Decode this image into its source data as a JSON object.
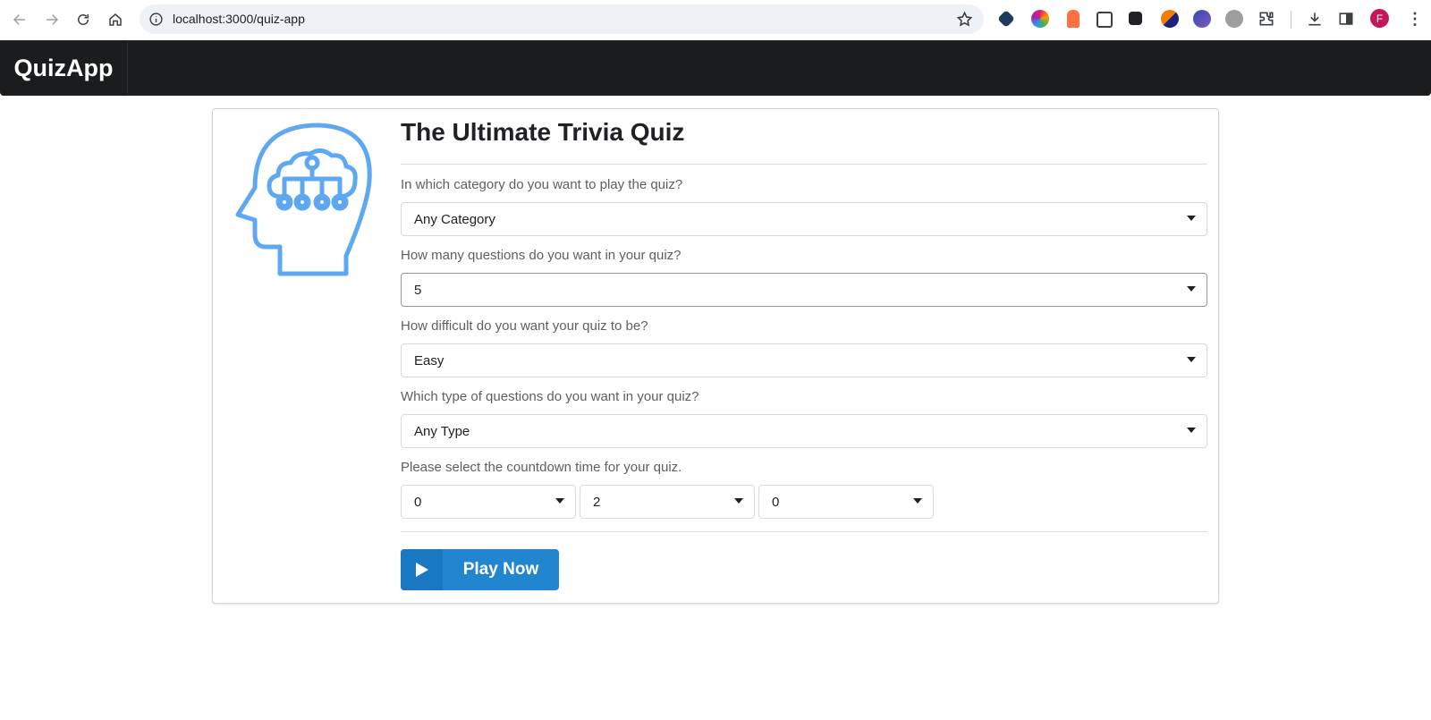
{
  "browser": {
    "url": "localhost:3000/quiz-app",
    "avatar_letter": "F"
  },
  "app": {
    "brand": "QuizApp"
  },
  "quiz": {
    "title": "The Ultimate Trivia Quiz",
    "category": {
      "label": "In which category do you want to play the quiz?",
      "value": "Any Category"
    },
    "questions": {
      "label": "How many questions do you want in your quiz?",
      "value": "5"
    },
    "difficulty": {
      "label": "How difficult do you want your quiz to be?",
      "value": "Easy"
    },
    "type": {
      "label": "Which type of questions do you want in your quiz?",
      "value": "Any Type"
    },
    "countdown": {
      "label": "Please select the countdown time for your quiz.",
      "hours": "0",
      "minutes": "2",
      "seconds": "0"
    },
    "play_button": "Play Now"
  },
  "colors": {
    "header_bg": "#1b1c1d",
    "icon_blue": "#5ea8f2",
    "button_blue": "#2185d0"
  },
  "icons": [
    "back-icon",
    "forward-icon",
    "reload-icon",
    "home-icon",
    "info-icon",
    "star-icon",
    "extensions-icon",
    "download-icon",
    "sidepanel-icon",
    "menu-icon",
    "brain-head-icon",
    "play-icon"
  ]
}
